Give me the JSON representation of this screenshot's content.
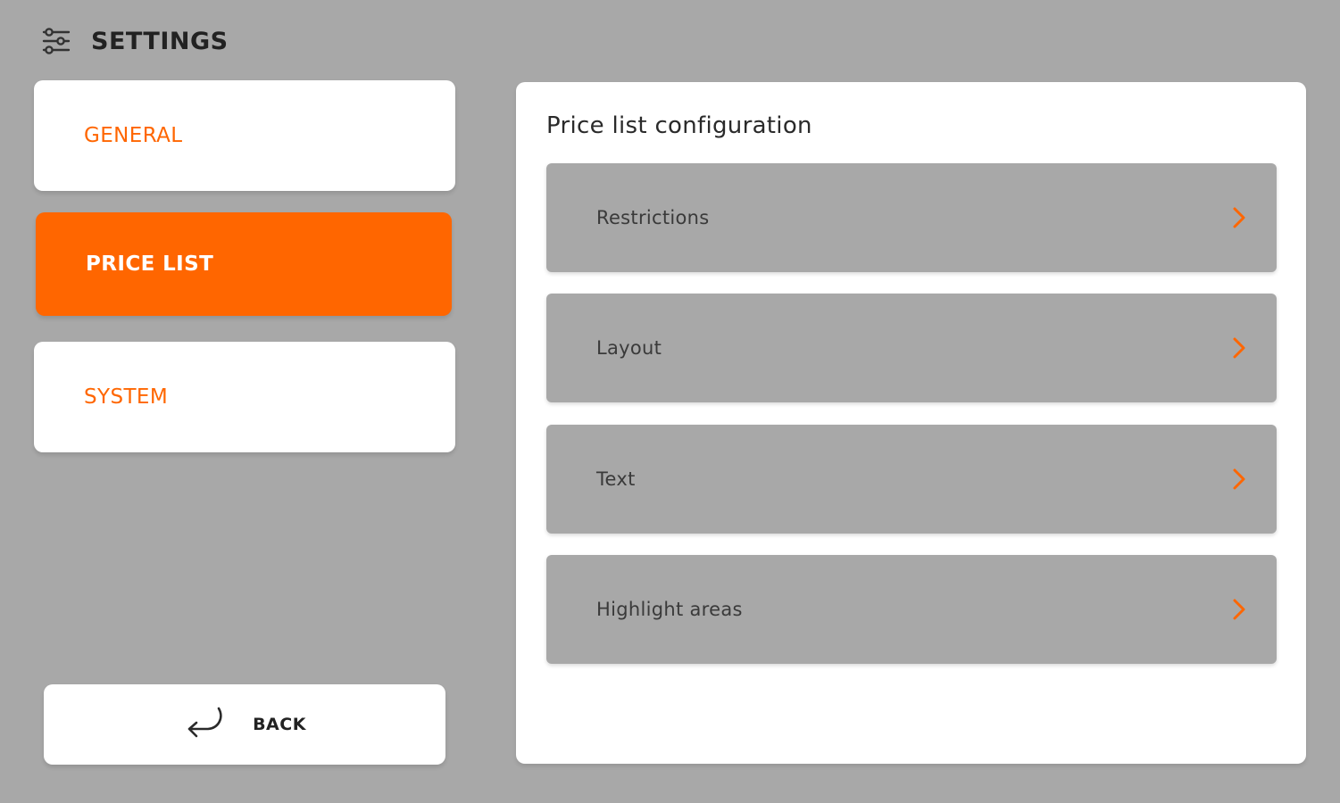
{
  "header": {
    "title": "SETTINGS",
    "icon": "sliders-icon"
  },
  "nav": {
    "items": [
      {
        "label": "GENERAL",
        "active": false
      },
      {
        "label": "PRICE LIST",
        "active": true
      },
      {
        "label": "SYSTEM",
        "active": false
      }
    ]
  },
  "back": {
    "label": "BACK",
    "icon": "return-arrow-icon"
  },
  "panel": {
    "title": "Price list configuration",
    "items": [
      {
        "label": "Restrictions",
        "icon": "chevron-right-icon"
      },
      {
        "label": "Layout",
        "icon": "chevron-right-icon"
      },
      {
        "label": "Text",
        "icon": "chevron-right-icon"
      },
      {
        "label": "Highlight areas",
        "icon": "chevron-right-icon"
      }
    ]
  },
  "colors": {
    "accent": "#ff6600",
    "background": "#a8a8a8",
    "surface": "#ffffff",
    "text": "#222222"
  }
}
